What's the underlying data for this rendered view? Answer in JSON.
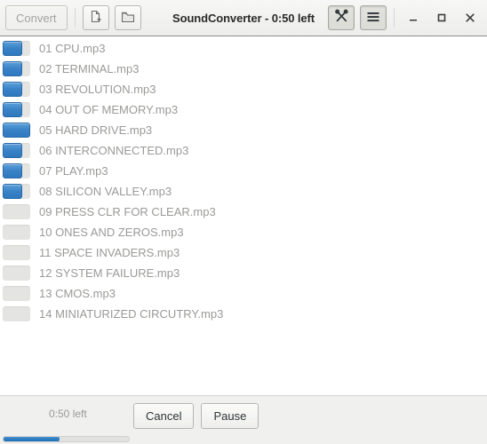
{
  "window": {
    "title": "SoundConverter - 0:50 left",
    "accent_color": "#3a82c6",
    "controls": {
      "minimize_label": "Minimize",
      "maximize_label": "Maximize",
      "close_label": "Close"
    }
  },
  "toolbar": {
    "convert_label": "Convert",
    "convert_disabled": true,
    "add_file_label": "Add File",
    "add_folder_label": "Add Folder",
    "preferences_label": "Preferences",
    "menu_label": "Main Menu"
  },
  "file_list": {
    "rows": [
      {
        "name": "01 CPU.mp3",
        "progress": 71
      },
      {
        "name": "02 TERMINAL.mp3",
        "progress": 71
      },
      {
        "name": "03 REVOLUTION.mp3",
        "progress": 71
      },
      {
        "name": "04 OUT OF MEMORY.mp3",
        "progress": 71
      },
      {
        "name": "05 HARD DRIVE.mp3",
        "progress": 100
      },
      {
        "name": "06 INTERCONNECTED.mp3",
        "progress": 71
      },
      {
        "name": "07 PLAY.mp3",
        "progress": 71
      },
      {
        "name": "08 SILICON VALLEY.mp3",
        "progress": 71
      },
      {
        "name": "09 PRESS CLR FOR CLEAR.mp3",
        "progress": 0
      },
      {
        "name": "10 ONES AND ZEROS.mp3",
        "progress": 0
      },
      {
        "name": "11 SPACE INVADERS.mp3",
        "progress": 0
      },
      {
        "name": "12 SYSTEM FAILURE.mp3",
        "progress": 0
      },
      {
        "name": "13 CMOS.mp3",
        "progress": 0
      },
      {
        "name": "14 MINIATURIZED CIRCUTRY.mp3",
        "progress": 0
      }
    ]
  },
  "status": {
    "eta_label": "0:50 left",
    "cancel_label": "Cancel",
    "pause_label": "Pause",
    "overall_progress": 45
  }
}
